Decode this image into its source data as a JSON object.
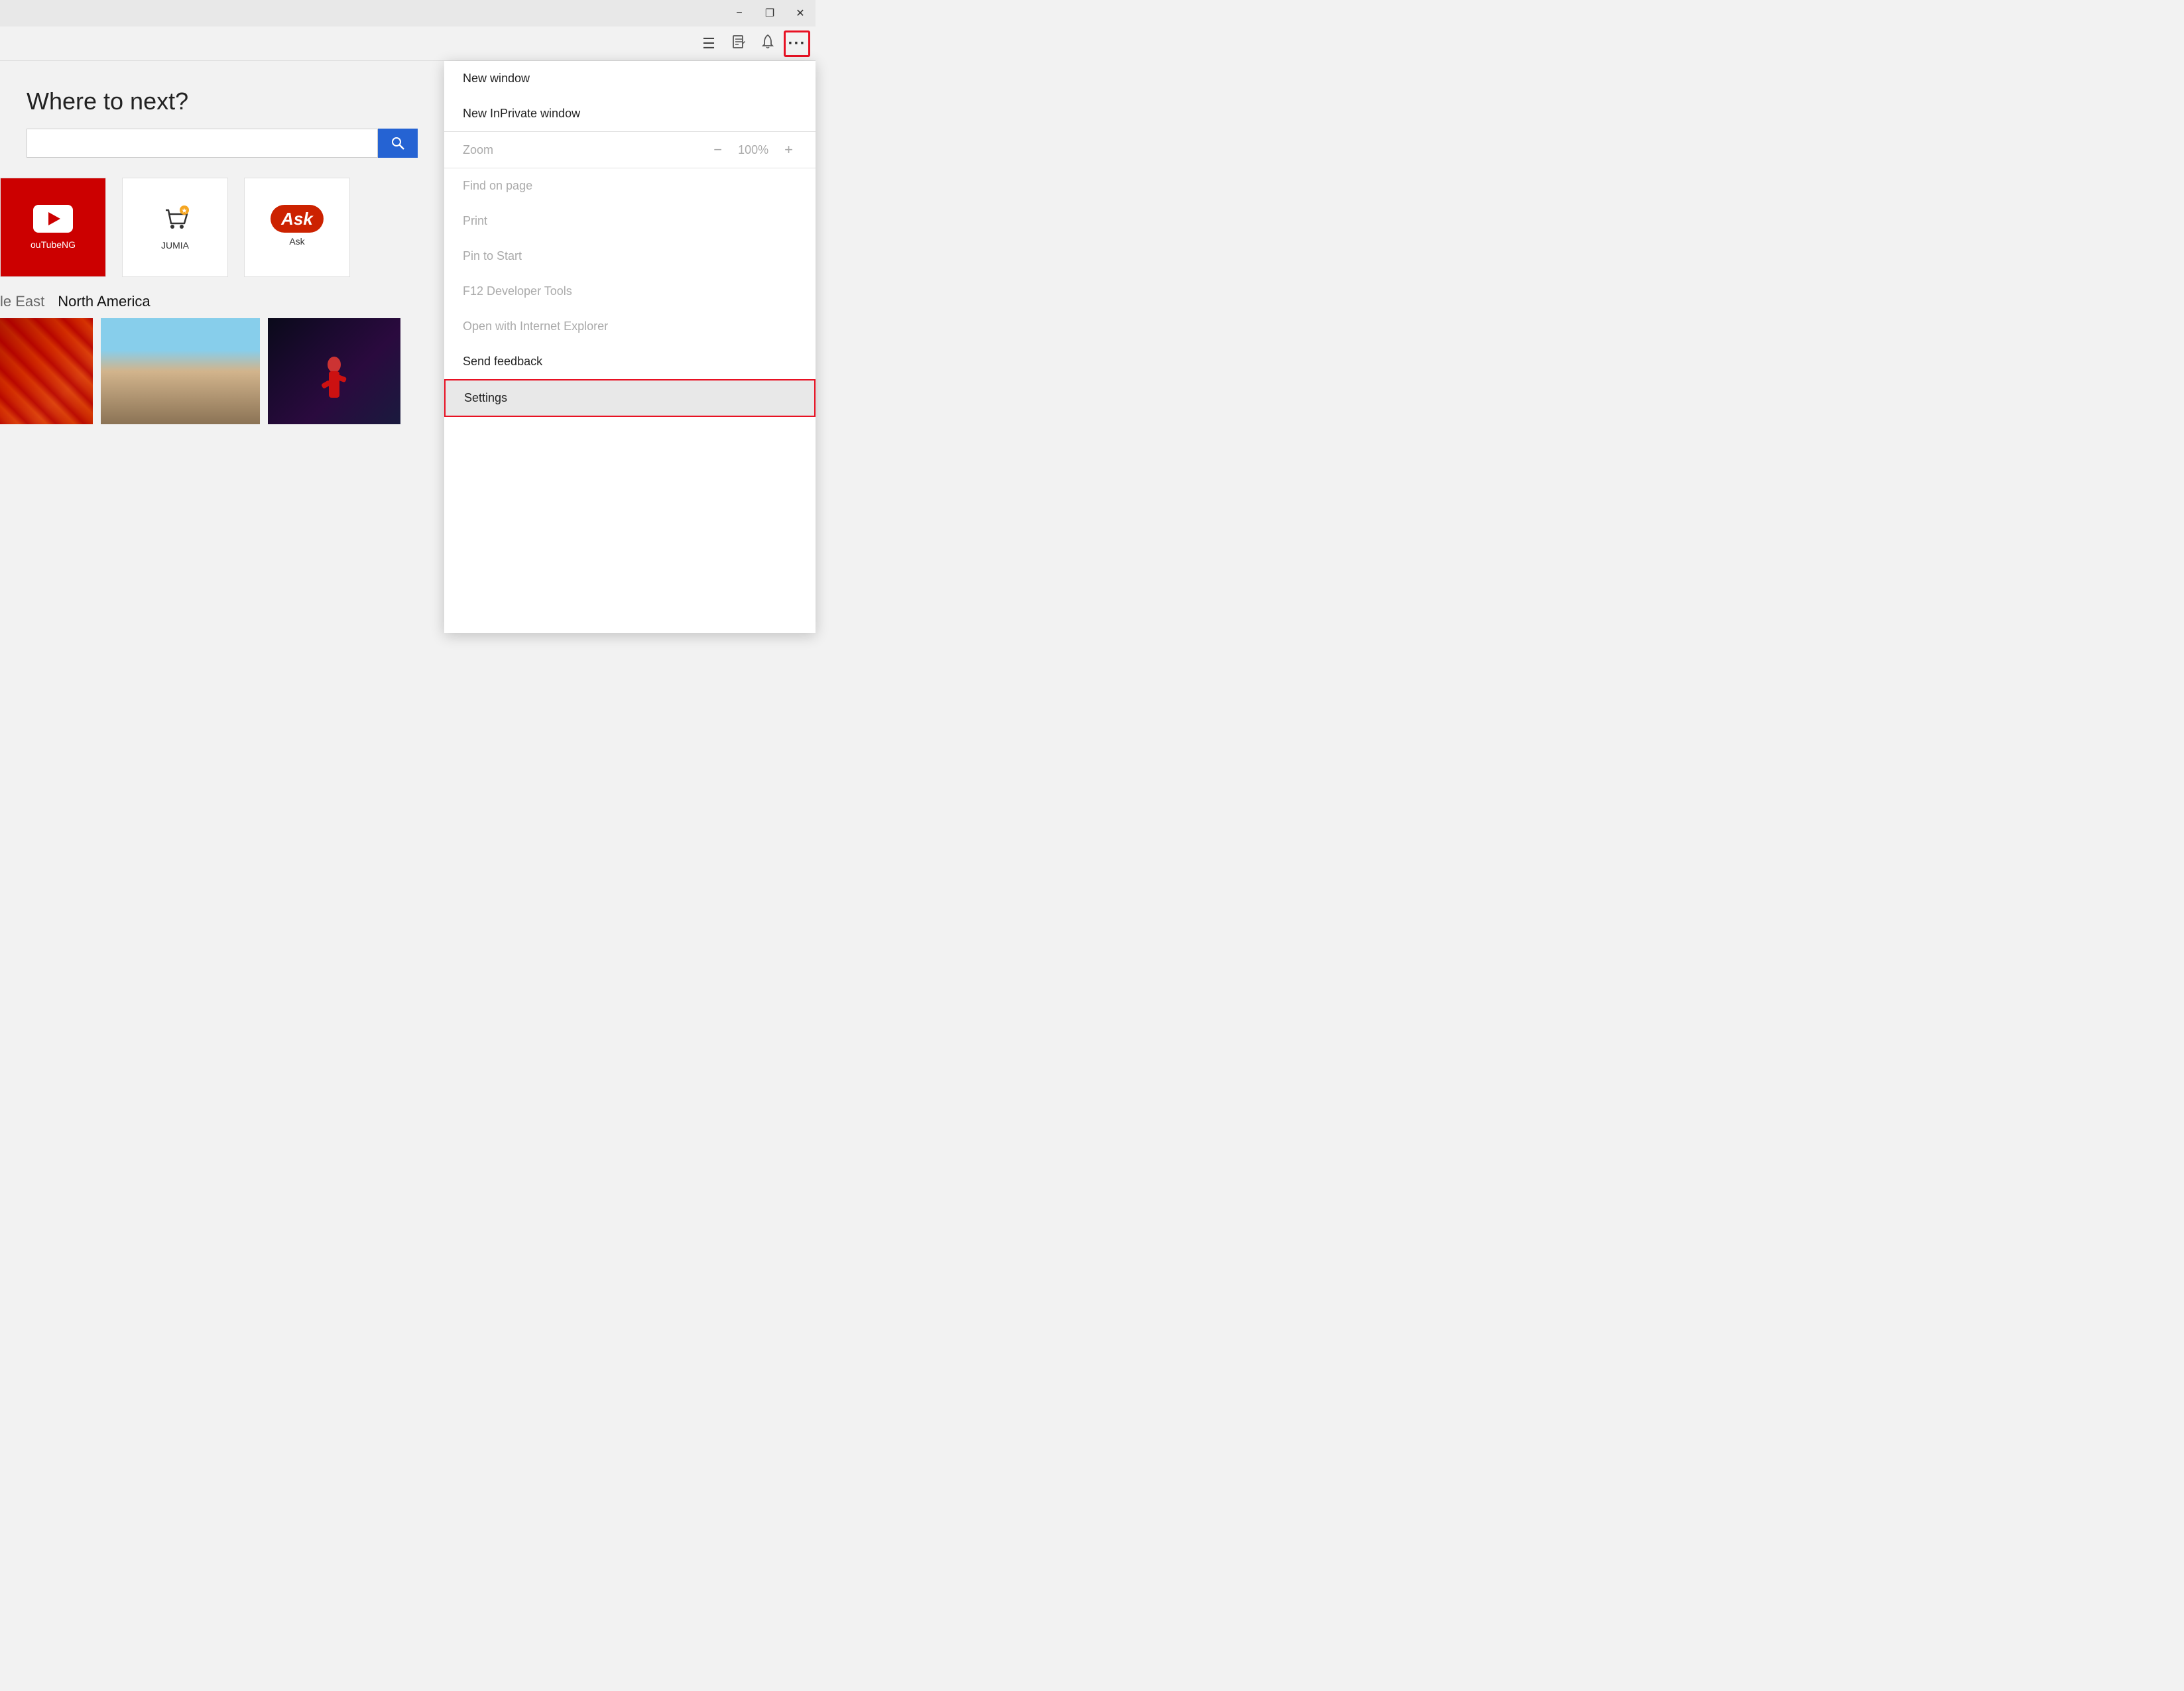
{
  "titlebar": {
    "minimize_label": "−",
    "restore_label": "❐",
    "close_label": "✕"
  },
  "toolbar": {
    "hub_icon": "☰",
    "notes_icon": "✎",
    "notifications_icon": "🔔",
    "more_icon": "···"
  },
  "page": {
    "heading": "Where to next?",
    "search_placeholder": "",
    "section_tag1": "le East",
    "section_tag2": "North America"
  },
  "quick_links": [
    {
      "id": "youtube",
      "label": "ouTubeNG",
      "type": "youtube"
    },
    {
      "id": "jumia",
      "label": "JUMIA",
      "type": "icon"
    },
    {
      "id": "ask",
      "label": "Ask",
      "type": "icon"
    }
  ],
  "menu": {
    "items": [
      {
        "id": "new-window",
        "label": "New window",
        "disabled": false
      },
      {
        "id": "new-inprivate",
        "label": "New InPrivate window",
        "disabled": false
      },
      {
        "id": "zoom-label",
        "label": "Zoom",
        "special": "zoom"
      },
      {
        "id": "find-on-page",
        "label": "Find on page",
        "disabled": true
      },
      {
        "id": "print",
        "label": "Print",
        "disabled": true
      },
      {
        "id": "pin-to-start",
        "label": "Pin to Start",
        "disabled": true
      },
      {
        "id": "f12-tools",
        "label": "F12 Developer Tools",
        "disabled": true
      },
      {
        "id": "open-ie",
        "label": "Open with Internet Explorer",
        "disabled": true
      },
      {
        "id": "send-feedback",
        "label": "Send feedback",
        "disabled": false
      },
      {
        "id": "settings",
        "label": "Settings",
        "disabled": false,
        "highlighted": true
      }
    ],
    "zoom_value": "100%",
    "zoom_minus": "−",
    "zoom_plus": "+"
  }
}
